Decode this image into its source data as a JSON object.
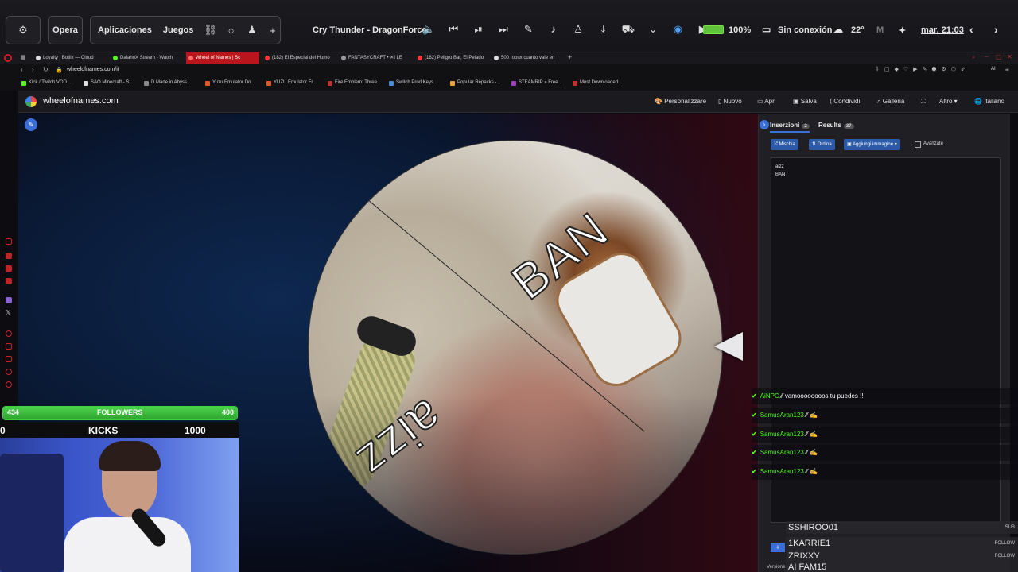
{
  "topbar": {
    "opera_label": "Opera",
    "aplicaciones": "Aplicaciones",
    "juegos": "Juegos",
    "now_playing": "Cry Thunder - DragonForce",
    "battery": "100%",
    "connection": "Sin conexión",
    "temperature": "22°",
    "datetime": "mar. 21:03"
  },
  "tabs": [
    {
      "label": "Loyalty | Botlix — Cloud",
      "color": "#cfcfcf"
    },
    {
      "label": "DalahoX Stream - Watch",
      "color": "#53fc18"
    },
    {
      "label": "Wheel of Names | Sc",
      "color": "#ff5555"
    },
    {
      "label": "(182) El Especial del Humo",
      "color": "#ff3333"
    },
    {
      "label": "FANTASYCRAFT • ✕I LE",
      "color": "#cfcfcf"
    },
    {
      "label": "(182) Peligro Bar, El Pelado",
      "color": "#ff3333"
    },
    {
      "label": "500 robux cuanto vale en",
      "color": "#cfcfcf"
    }
  ],
  "address": "wheelofnames.com/it",
  "bookmarks": [
    "Kick / Twitch VOD...",
    "SAO Minecraft - S...",
    "D Made in Abyss...",
    "Yuzu Emulator Do...",
    "YUZU Emulator Fr...",
    "Fire Emblem: Three...",
    "Switch Prod Keys...",
    "Popular Repacks -...",
    "STEAMRIP » Free...",
    "Most Downloaded..."
  ],
  "site": {
    "name": "wheelofnames.com",
    "menu": [
      "Personalizzare",
      "Nuovo",
      "Apri",
      "Salva",
      "Condividi",
      "Galleria",
      "Altro",
      "Italiano"
    ]
  },
  "wheel": {
    "labels": [
      "BAN",
      "aizz"
    ]
  },
  "panel": {
    "tab_insertions": "Inserzioni",
    "insertions_count": "2",
    "tab_results": "Results",
    "results_count": "37",
    "btn_shuffle": "Mischia",
    "btn_sort": "Ordina",
    "btn_add_image": "Aggiungi immagine",
    "advanced": "Avanzate",
    "entries": [
      "aizz",
      "BAN"
    ],
    "version": "Versione"
  },
  "chat": [
    {
      "user": "AiNPC",
      "msg": "vamoooooooos tu puedes !!"
    },
    {
      "user": "SamusAran123",
      "msg": ""
    },
    {
      "user": "SamusAran123",
      "msg": ""
    },
    {
      "user": "SamusAran123",
      "msg": ""
    },
    {
      "user": "SamusAran123",
      "msg": ""
    }
  ],
  "alerts": [
    {
      "name": "SSHIROO01",
      "tag": "SUB"
    },
    {
      "name": "1KARRIE1",
      "tag": "FOLLOW"
    },
    {
      "name": "ZRIXXY",
      "tag": "FOLLOW"
    },
    {
      "name": "AI FAM15",
      "tag": ""
    }
  ],
  "overlay": {
    "followers_current": "434",
    "followers_label": "FOLLOWERS",
    "followers_goal": "400",
    "followers_progress": 1.0,
    "kicks_current": "0",
    "kicks_label": "KICKS",
    "kicks_goal": "1000"
  },
  "colors": {
    "accent_blue": "#2b5aa8",
    "kick_green": "#53fc18",
    "active_tab_red": "#b8151d"
  }
}
